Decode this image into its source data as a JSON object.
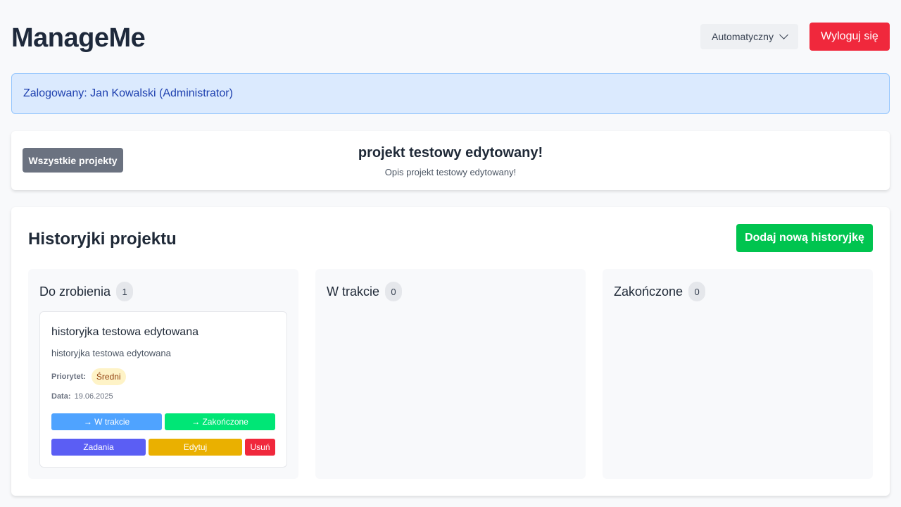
{
  "header": {
    "app_title": "ManageMe",
    "theme_select": {
      "value": "Automatyczny"
    },
    "logout_label": "Wyloguj się"
  },
  "login_banner": {
    "text": "Zalogowany: Jan Kowalski (Administrator)"
  },
  "project_bar": {
    "all_projects_label": "Wszystkie projekty",
    "project_name": "projekt testowy edytowany!",
    "project_description": "Opis projekt testowy edytowany!"
  },
  "stories": {
    "title": "Historyjki projektu",
    "add_label": "Dodaj nową historyjkę",
    "columns": [
      {
        "title": "Do zrobienia",
        "count": "1",
        "cards": [
          {
            "title": "historyjka testowa edytowana",
            "description": "historyjka testowa edytowana",
            "priority_label": "Priorytet:",
            "priority": "Średni",
            "date_label": "Data:",
            "date": "19.06.2025",
            "actions": {
              "to_progress": "→ W trakcie",
              "to_done": "→ Zakończone",
              "tasks": "Zadania",
              "edit": "Edytuj",
              "delete": "Usuń"
            }
          }
        ]
      },
      {
        "title": "W trakcie",
        "count": "0",
        "cards": []
      },
      {
        "title": "Zakończone",
        "count": "0",
        "cards": []
      }
    ]
  },
  "colors": {
    "logout": "#f0283c",
    "add_story": "#00c44f",
    "banner_bg": "#dbeafe",
    "to_progress": "#4fa3ff",
    "to_done": "#00e676",
    "tasks": "#5b5ef4",
    "edit": "#eab000",
    "delete": "#f0283c"
  }
}
